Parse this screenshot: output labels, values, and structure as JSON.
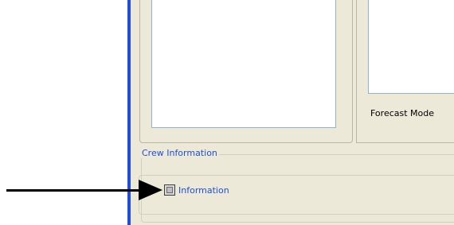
{
  "panels": {
    "forecast_mode_label": "Forecast Mode"
  },
  "crew_information": {
    "group_label": "Crew Information",
    "checkbox_label": "Information",
    "checkbox_checked": false
  },
  "colors": {
    "window_bg": "#ece9d8",
    "accent_blue": "#1f4fd8",
    "list_border": "#8fb5c9",
    "arrow": "#000000"
  },
  "icons": {
    "annotation_arrow": "arrow-right-icon"
  }
}
